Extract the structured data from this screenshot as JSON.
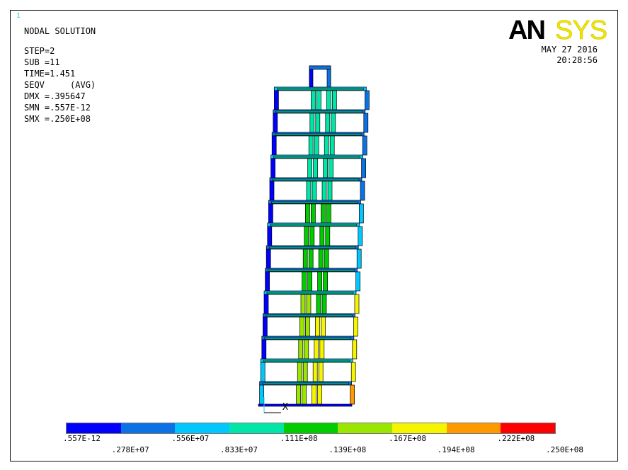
{
  "window": {
    "number": "1"
  },
  "header": {
    "title": "NODAL SOLUTION",
    "lines": [
      "STEP=2",
      "SUB =11",
      "TIME=1.451",
      "SEQV     (AVG)",
      "DMX =.395647",
      "SMN =.557E-12",
      "SMX =.250E+08"
    ]
  },
  "logo": {
    "text_dark": "AN",
    "text_light": "SYS",
    "dark_color": "#000000",
    "light_color": "#f2e600"
  },
  "date": "MAY 27 2016",
  "time": "20:28:56",
  "triad": {
    "axis_label": "X"
  },
  "legend": {
    "colors": [
      "#0000ff",
      "#0b72e6",
      "#00c8ff",
      "#00e6a8",
      "#00cc00",
      "#9be600",
      "#f5f500",
      "#ff9900",
      "#ff0000"
    ],
    "labels_top": [
      ".557E-12",
      ".556E+07",
      ".111E+08",
      ".167E+08",
      ".222E+08"
    ],
    "labels_bottom": [
      ".278E+07",
      ".833E+07",
      ".139E+08",
      ".194E+08",
      ".250E+08"
    ]
  }
}
